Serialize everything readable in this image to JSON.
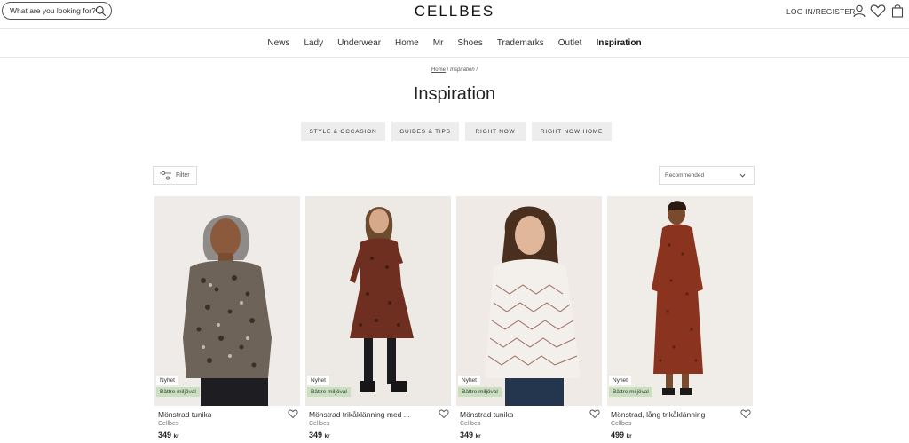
{
  "header": {
    "search_placeholder": "What are you looking for?",
    "logo": "CELLBES",
    "login_label": "LOG IN/REGISTER"
  },
  "icons": {
    "search": "search-icon",
    "user": "user-icon",
    "wishlist": "heart-icon",
    "cart": "shopping-bag-icon",
    "filter": "sliders-icon",
    "sort": "chevron-down-icon",
    "favorite": "heart-icon"
  },
  "nav": {
    "items": [
      {
        "label": "News",
        "active": false
      },
      {
        "label": "Lady",
        "active": false
      },
      {
        "label": "Underwear",
        "active": false
      },
      {
        "label": "Home",
        "active": false
      },
      {
        "label": "Mr",
        "active": false
      },
      {
        "label": "Shoes",
        "active": false
      },
      {
        "label": "Trademarks",
        "active": false
      },
      {
        "label": "Outlet",
        "active": false
      },
      {
        "label": "Inspiration",
        "active": true
      }
    ]
  },
  "breadcrumb": {
    "home": "Home",
    "separator": "/",
    "current": "Inspiration",
    "trailing": "/"
  },
  "page": {
    "title": "Inspiration"
  },
  "categories": [
    {
      "label": "STYLE & OCCASION"
    },
    {
      "label": "GUIDES & TIPS"
    },
    {
      "label": "RIGHT NOW"
    },
    {
      "label": "RIGHT NOW HOME"
    }
  ],
  "toolbar": {
    "filter_label": "Filter",
    "sort_selected": "Recommended"
  },
  "colors": {
    "eco_badge": "#c9e0bf",
    "category_bg": "#ededed",
    "text_dark": "#222222"
  },
  "products": [
    {
      "badge_new": "Nyhet",
      "badge_eco": "Bättre miljöval",
      "name": "Mönstrad tunika",
      "brand": "Cellbes",
      "price": "349",
      "currency": "kr"
    },
    {
      "badge_new": "Nyhet",
      "badge_eco": "Bättre miljöval",
      "name": "Mönstrad trikåklänning med ...",
      "brand": "Cellbes",
      "price": "349",
      "currency": "kr"
    },
    {
      "badge_new": "Nyhet",
      "badge_eco": "Bättre miljöval",
      "name": "Mönstrad tunika",
      "brand": "Cellbes",
      "price": "349",
      "currency": "kr"
    },
    {
      "badge_new": "Nyhet",
      "badge_eco": "Bättre miljöval",
      "name": "Mönstrad, lång trikåklänning",
      "brand": "Cellbes",
      "price": "499",
      "currency": "kr"
    }
  ]
}
